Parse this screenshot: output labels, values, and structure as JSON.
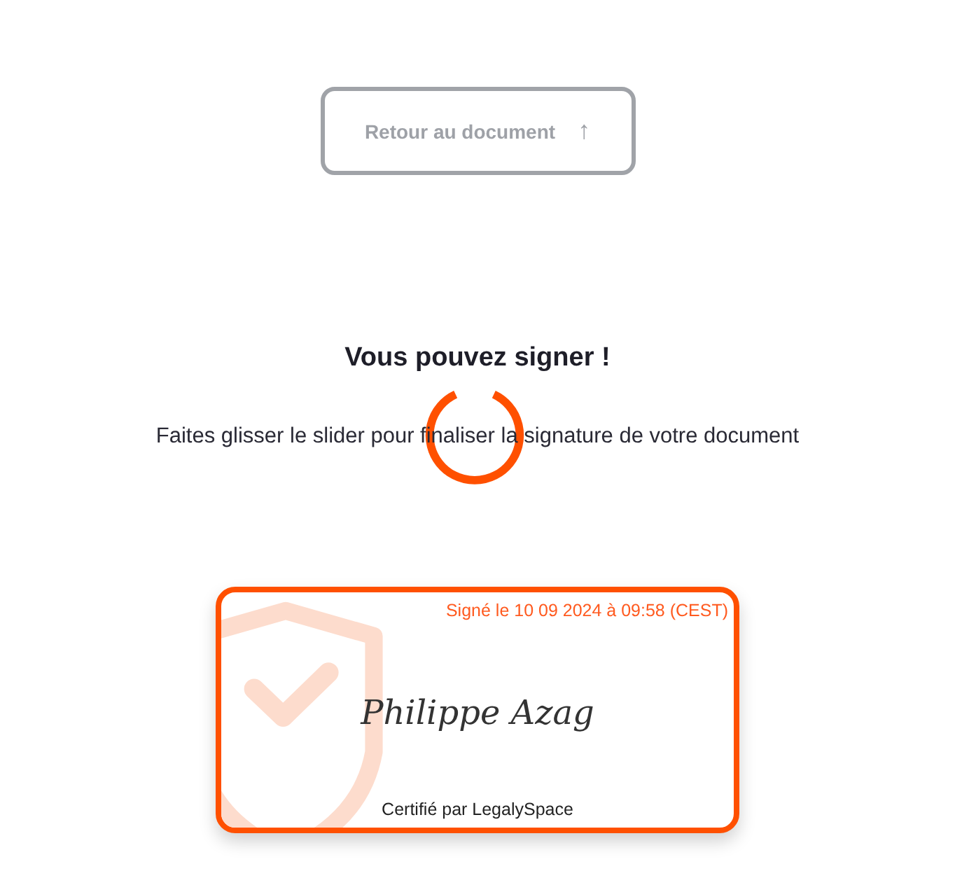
{
  "back_button": {
    "label": "Retour au document",
    "icon": "↑"
  },
  "heading": "Vous pouvez signer !",
  "instruction": "Faites glisser le slider pour finaliser la signature de votre document",
  "signature_card": {
    "signed_at": "Signé le 10 09 2024 à 09:58 (CEST)",
    "signer": "Philippe Azag",
    "certified_by": "Certifié par LegalySpace"
  }
}
